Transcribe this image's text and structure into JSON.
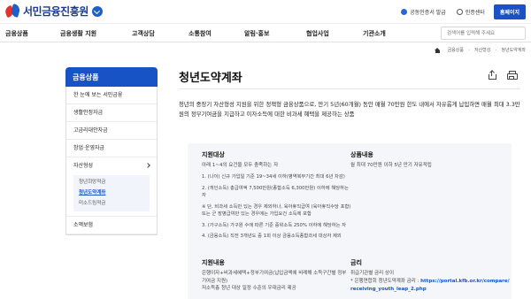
{
  "header": {
    "logo_text": "서민금융진흥원",
    "links": [
      {
        "label": "공동인증서 발급",
        "icon": "certificate-icon"
      },
      {
        "label": "인증센터",
        "icon": "auth-center-icon"
      }
    ],
    "home_button": "홈페이지"
  },
  "gnb": {
    "items": [
      "금융상품",
      "금융생활 지원",
      "고객상담",
      "소통참여",
      "알림·홍보",
      "협업사업",
      "기관소개"
    ],
    "search_placeholder": "검색어를 입력해 주세요"
  },
  "breadcrumb": [
    "금융상품",
    "자산형성",
    "청년도약계좌"
  ],
  "sidebar": {
    "title": "금융상품",
    "items": [
      "한 눈에 보는 서민금융",
      "생활안정자금",
      "고금리대안자금",
      "창업·운영자금",
      "자산형성",
      "소액보험"
    ],
    "sub_items": [
      "청년희망적금",
      "청년도약계좌",
      "미소드림적금"
    ],
    "active_sub": "청년도약계좌"
  },
  "main": {
    "title": "청년도약계좌",
    "intro": "청년의 중장기 자산형성 지원을 위한 정책형 금융상품으로, 만기 5년(60개월) 동안 매월 70만원 한도 내에서 자유롭게 납입하면 매월 최대 3.3만원의 정부기여금을 지급하고 이자소득에 대한 비과세 혜택을 제공하는 상품",
    "sections": {
      "eligibility": {
        "title": "지원대상",
        "summary": "아래 1~4의 요건을 모두 충족하는 자",
        "conditions": [
          "1. (나이) 신규 가입일 기준 19~34세 이하(병역복무기간 최대 6년 차감)",
          "2. (개인소득) 총급여액 7,500만원(종합소득 6,300만원) 이하에 해당하는 자",
          "※ 단, 비과세 소득만 있는 경우 제외하나, 육아휴직급여 (육아휴직수당 포함) 또는 군 장병급여만 있는 경우에는 가입요건 소득에 포함",
          "3. (가구소득) 가구원 수에 따른 기준 중위소득 250% 이하에 해당하는 자",
          "4. (금융소득) 직전 3개년도 중 1회 이상 금융소득종합과세 대상자 제외"
        ]
      },
      "product": {
        "title": "상품내용",
        "text": "월 최대 70만원 이하 5년 만기 자유적립"
      },
      "support": {
        "title": "지원내용",
        "lines": [
          "은행이자+비과세혜택+정부기여금(납입금액에 비례해 소득구간별 정부기여금 지원)",
          "저소득층 청년 대상 일정 수준의 우대금리 제공"
        ]
      },
      "apply": {
        "title": "금리",
        "line1": "취급기관별 금리 상이",
        "line2_prefix": "* 은행연합회 청년도약계좌 금리 :",
        "url": "https://portal.kfb.or.kr/compare/receiving_youth_leap_2.php"
      }
    }
  }
}
